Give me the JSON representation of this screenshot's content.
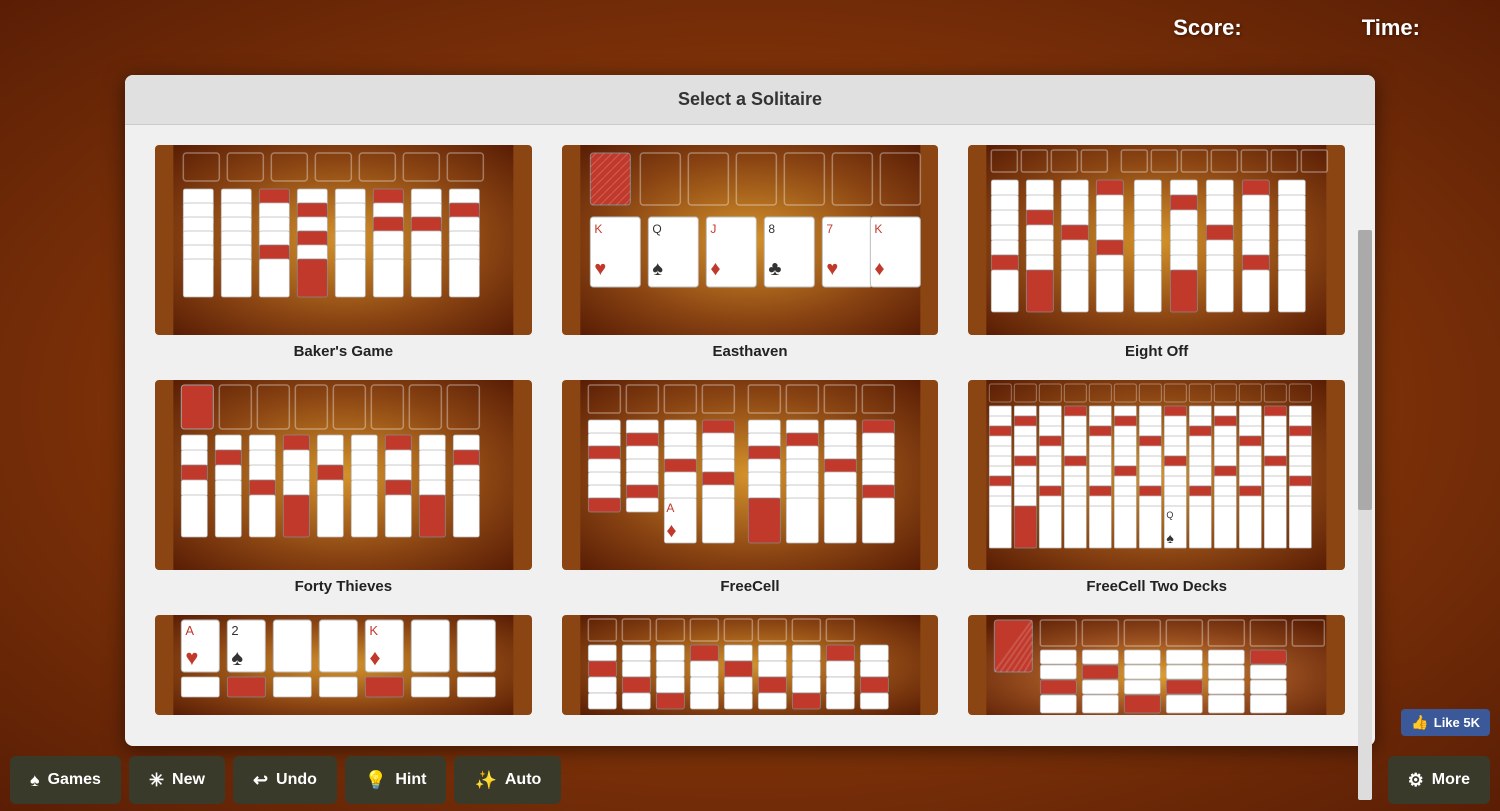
{
  "header": {
    "score_label": "Score:",
    "time_label": "Time:"
  },
  "modal": {
    "title": "Select a Solitaire",
    "games": [
      {
        "id": "bakers-game",
        "name": "Baker's Game",
        "type": "columns"
      },
      {
        "id": "easthaven",
        "name": "Easthaven",
        "type": "deal"
      },
      {
        "id": "eight-off",
        "name": "Eight Off",
        "type": "freecell"
      },
      {
        "id": "forty-thieves",
        "name": "Forty Thieves",
        "type": "wide"
      },
      {
        "id": "freecell",
        "name": "FreeCell",
        "type": "freecell2"
      },
      {
        "id": "freecell-two",
        "name": "FreeCell Two Decks",
        "type": "freecell-wide"
      },
      {
        "id": "game7",
        "name": "",
        "type": "partial"
      },
      {
        "id": "game8",
        "name": "",
        "type": "partial2"
      },
      {
        "id": "game9",
        "name": "",
        "type": "partial3"
      }
    ]
  },
  "toolbar": {
    "games_label": "Games",
    "new_label": "New",
    "undo_label": "Undo",
    "hint_label": "Hint",
    "auto_label": "Auto",
    "more_label": "More"
  },
  "fb_like": "Like 5K",
  "colors": {
    "bg_dark": "#5a1e05",
    "bg_mid": "#8b3a0a",
    "bg_light": "#c8701a",
    "toolbar_bg": "#3a3a2a",
    "modal_bg": "#f0f0f0",
    "modal_header_bg": "#e0e0e0"
  }
}
